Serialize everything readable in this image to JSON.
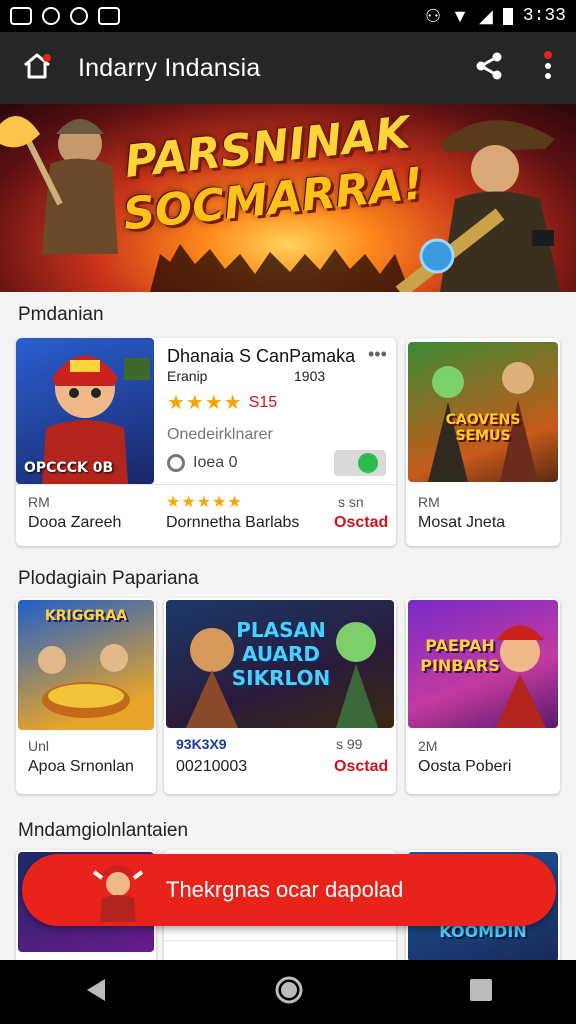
{
  "status": {
    "time": "3:33"
  },
  "appbar": {
    "title": "Indarry Indansia"
  },
  "banner": {
    "line1": "PARSNINAK",
    "line2": "SOCMARRA!"
  },
  "sections": [
    {
      "title": "Pmdanian"
    },
    {
      "title": "Plodagiain Papariana"
    },
    {
      "title": "Mndamgiolnlantaien"
    }
  ],
  "featured": {
    "title": "Dhanaia S CanPamaka",
    "sub": "Eranip",
    "year": "1903",
    "rating_value": "S15",
    "desc": "Onedeirklnarer",
    "install_label": "Ioea 0",
    "thumb_label": "OPCCCK 0B"
  },
  "row1": [
    {
      "size": "RM",
      "name": "Dooa Zareeh"
    },
    {
      "name": "Dornnetha Barlabs",
      "extra": "s  sn",
      "status": "Osctad"
    },
    {
      "size": "RM",
      "name": "Mosat Jneta",
      "thumb_title": "CAOVENS SEMUS"
    }
  ],
  "row2": [
    {
      "size": "Unl",
      "name": "Apoa Srnonlan",
      "thumb_title": "KRIGGRAA"
    },
    {
      "sub": "93K3X9",
      "name": "00210003",
      "extra": "s  99",
      "status": "Osctad",
      "thumb_title": "PLASAN AUARD SIKRLON"
    },
    {
      "size": "2M",
      "name": "Oosta Poberi",
      "thumb_title": "PAEPAH PINBARS"
    }
  ],
  "row3": [
    {
      "thumb_title": "KOOMDIN"
    }
  ],
  "cta": {
    "label": "Thekrgnas ocar dapolad"
  }
}
